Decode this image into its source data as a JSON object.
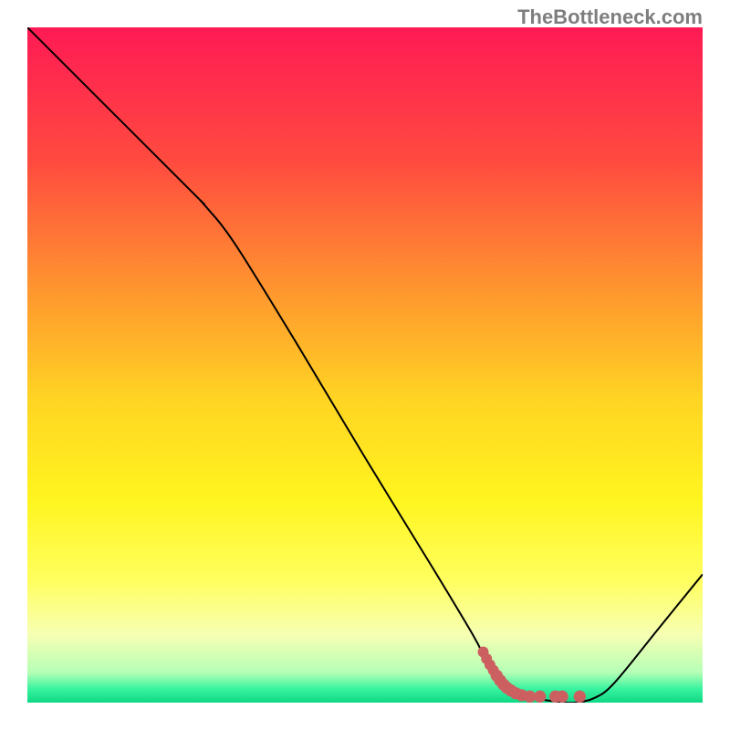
{
  "watermark": "TheBottleneck.com",
  "chart_data": {
    "type": "line",
    "title": "",
    "xlabel": "",
    "ylabel": "",
    "xlim": [
      0,
      100
    ],
    "ylim": [
      0,
      100
    ],
    "curve": [
      {
        "x": 0.0,
        "y": 100.0
      },
      {
        "x": 24.0,
        "y": 76.0
      },
      {
        "x": 25.5,
        "y": 74.5
      },
      {
        "x": 27.0,
        "y": 72.8
      },
      {
        "x": 29.0,
        "y": 70.4
      },
      {
        "x": 32.0,
        "y": 66.0
      },
      {
        "x": 40.0,
        "y": 53.0
      },
      {
        "x": 50.0,
        "y": 36.3
      },
      {
        "x": 60.0,
        "y": 20.0
      },
      {
        "x": 66.0,
        "y": 10.0
      },
      {
        "x": 68.0,
        "y": 6.2
      },
      {
        "x": 70.0,
        "y": 3.5
      },
      {
        "x": 72.0,
        "y": 1.8
      },
      {
        "x": 75.0,
        "y": 0.7
      },
      {
        "x": 78.0,
        "y": 0.2
      },
      {
        "x": 81.0,
        "y": 0.0
      },
      {
        "x": 84.0,
        "y": 0.7
      },
      {
        "x": 87.0,
        "y": 3.0
      },
      {
        "x": 93.5,
        "y": 11.0
      },
      {
        "x": 100.0,
        "y": 19.0
      }
    ],
    "highlight_dots": [
      {
        "x": 67.5,
        "y": 7.5,
        "r": 0.9
      },
      {
        "x": 68.0,
        "y": 6.5,
        "r": 0.9
      },
      {
        "x": 68.5,
        "y": 5.6,
        "r": 0.9
      },
      {
        "x": 69.0,
        "y": 4.8,
        "r": 0.9
      },
      {
        "x": 69.5,
        "y": 4.0,
        "r": 1.0
      },
      {
        "x": 70.0,
        "y": 3.3,
        "r": 1.0
      },
      {
        "x": 70.5,
        "y": 2.7,
        "r": 1.0
      },
      {
        "x": 71.0,
        "y": 2.2,
        "r": 1.0
      },
      {
        "x": 71.6,
        "y": 1.8,
        "r": 1.0
      },
      {
        "x": 72.3,
        "y": 1.4,
        "r": 1.0
      },
      {
        "x": 73.2,
        "y": 1.1,
        "r": 1.0
      },
      {
        "x": 74.4,
        "y": 0.9,
        "r": 1.0
      },
      {
        "x": 75.9,
        "y": 0.9,
        "r": 1.0
      },
      {
        "x": 78.2,
        "y": 0.9,
        "r": 1.0
      },
      {
        "x": 79.2,
        "y": 0.9,
        "r": 1.0
      },
      {
        "x": 81.8,
        "y": 0.9,
        "r": 1.0
      }
    ],
    "gradient_stops": [
      {
        "pos": 0.0,
        "color": "#ff1a55"
      },
      {
        "pos": 0.2,
        "color": "#ff4b3f"
      },
      {
        "pos": 0.4,
        "color": "#ff9a2e"
      },
      {
        "pos": 0.55,
        "color": "#ffd423"
      },
      {
        "pos": 0.7,
        "color": "#fff51f"
      },
      {
        "pos": 0.82,
        "color": "#ffff60"
      },
      {
        "pos": 0.9,
        "color": "#f6ffb3"
      },
      {
        "pos": 0.955,
        "color": "#b6ffb6"
      },
      {
        "pos": 0.98,
        "color": "#37f39f"
      },
      {
        "pos": 1.0,
        "color": "#0fd885"
      }
    ],
    "dot_color": "#cc6060",
    "line_color": "#000000"
  }
}
